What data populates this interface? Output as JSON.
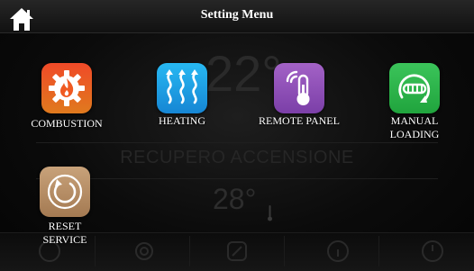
{
  "header": {
    "title": "Setting Menu",
    "home_icon": "home-icon"
  },
  "background": {
    "temperature": "22°",
    "status": "RECUPERO ACCENSIONE",
    "set_temperature": "28°"
  },
  "menu_items": [
    {
      "label": "COMBUSTION",
      "icon": "flame-gear-icon",
      "color_top": "#f04a28",
      "color_bottom": "#e07a1e"
    },
    {
      "label": "HEATING",
      "icon": "heat-waves-icon",
      "color_top": "#27b8f2",
      "color_bottom": "#1686d4"
    },
    {
      "label": "REMOTE PANEL",
      "icon": "remote-thermometer-icon",
      "color_top": "#a362c6",
      "color_bottom": "#7b3fa8"
    },
    {
      "label": "MANUAL\nLOADING",
      "icon": "auger-loading-icon",
      "color_top": "#3bc45a",
      "color_bottom": "#20a43d"
    },
    {
      "label": "RESET\nSERVICE",
      "icon": "reset-icon",
      "color_top": "#c8a27a",
      "color_bottom": "#a47a52"
    }
  ],
  "footer_icons": [
    "power-icon",
    "gear-icon",
    "edit-icon",
    "info-icon",
    "history-icon"
  ]
}
